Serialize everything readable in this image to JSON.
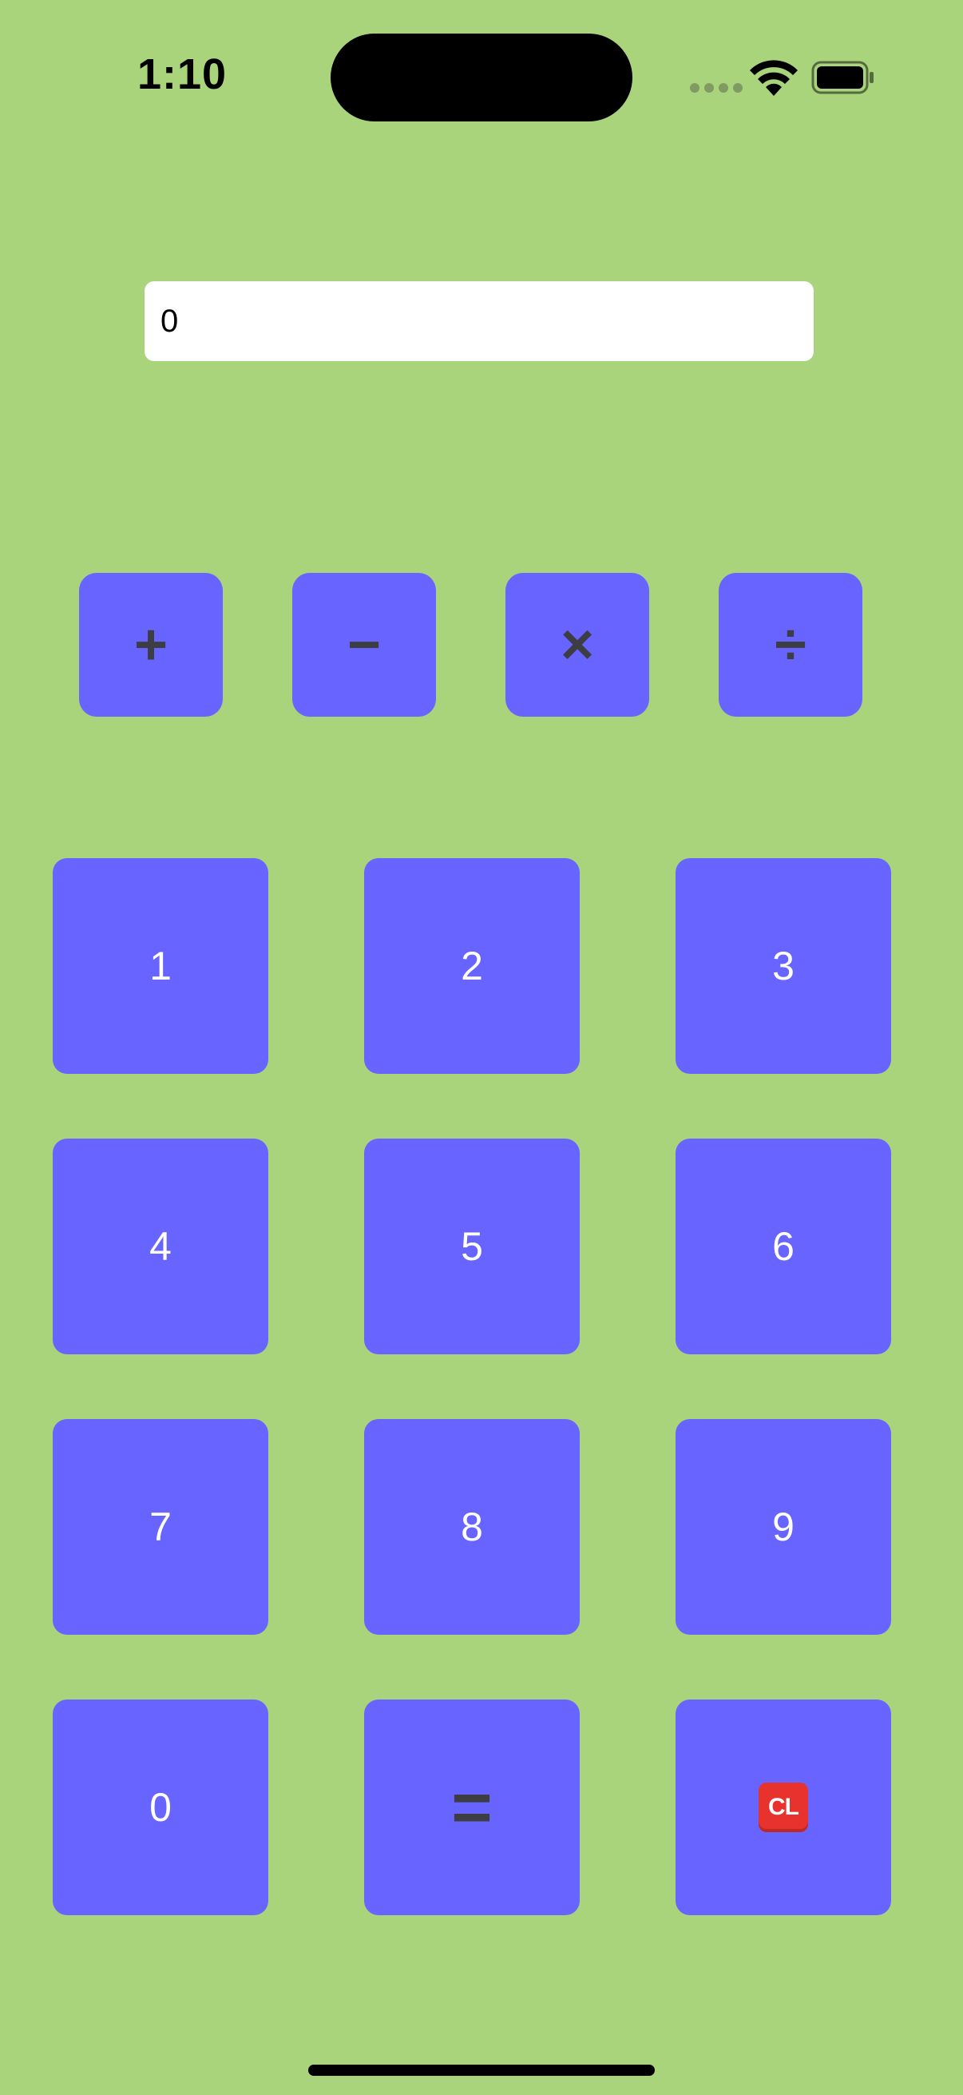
{
  "status_bar": {
    "time": "1:10",
    "icons": [
      "signal-icon",
      "wifi-icon",
      "battery-icon"
    ]
  },
  "display": {
    "value": "0"
  },
  "operators": [
    {
      "label": "+",
      "name": "plus"
    },
    {
      "label": "−",
      "name": "minus"
    },
    {
      "label": "×",
      "name": "multiply"
    },
    {
      "label": "÷",
      "name": "divide"
    }
  ],
  "keypad": {
    "rows": [
      [
        "1",
        "2",
        "3"
      ],
      [
        "4",
        "5",
        "6"
      ],
      [
        "7",
        "8",
        "9"
      ]
    ],
    "zero": "0",
    "equals": "=",
    "clear": "CL"
  },
  "colors": {
    "background": "#aad47c",
    "button": "#6864ff",
    "operator_text": "#3d3d44",
    "digit_text": "#ffffff",
    "clear_badge": "#e8322d"
  }
}
